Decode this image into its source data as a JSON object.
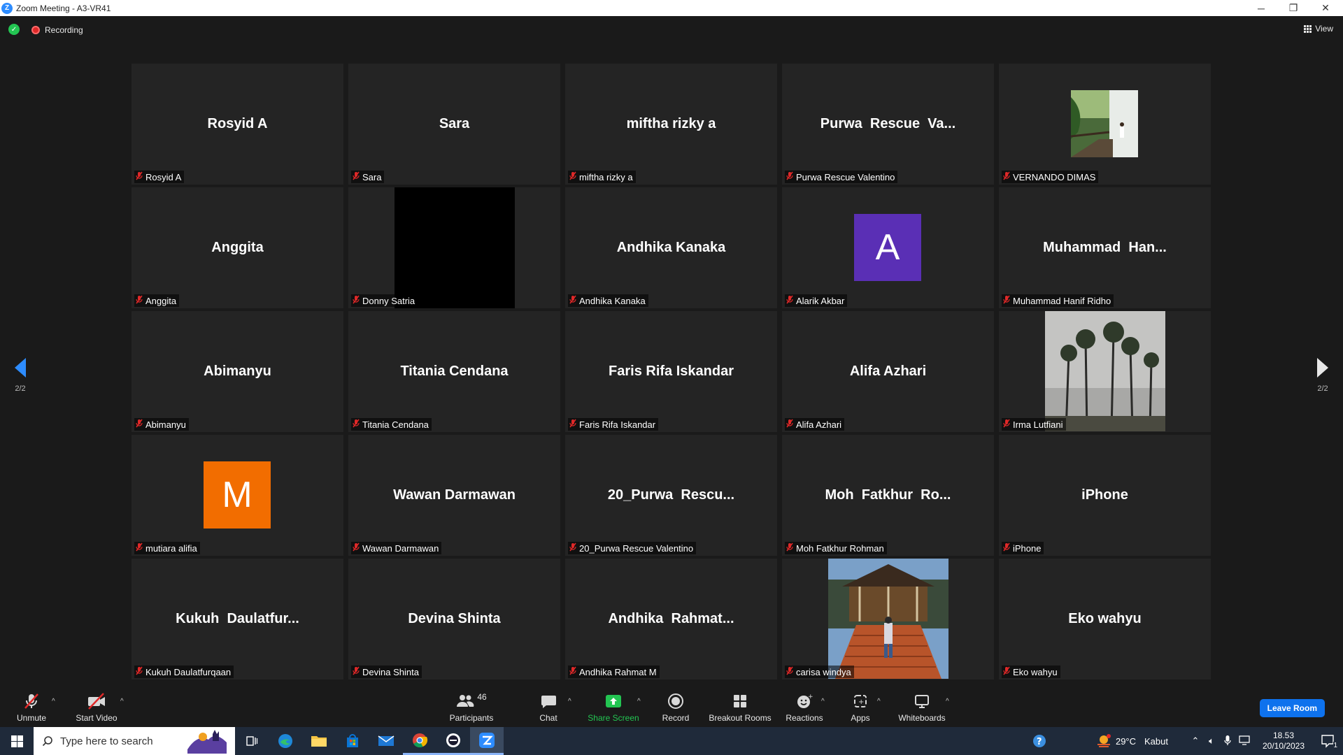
{
  "window": {
    "title": "Zoom Meeting - A3-VR41",
    "logo_letter": "Z",
    "min_glyph": "─",
    "restore_glyph": "❐",
    "close_glyph": "✕"
  },
  "topbar": {
    "recording_label": "Recording",
    "view_label": "View"
  },
  "pagination": {
    "left": "2/2",
    "right": "2/2"
  },
  "tiles": [
    {
      "display": "Rosyid A",
      "label": "Rosyid A",
      "kind": "name"
    },
    {
      "display": "Sara",
      "label": "Sara",
      "kind": "name"
    },
    {
      "display": "miftha rizky a",
      "label": "miftha rizky a",
      "kind": "name"
    },
    {
      "display": "Purwa  Rescue  Va...",
      "label": "Purwa Rescue Valentino",
      "kind": "name"
    },
    {
      "display": "",
      "label": "VERNANDO DIMAS",
      "kind": "photo-jungle"
    },
    {
      "display": "Anggita",
      "label": "Anggita",
      "kind": "name"
    },
    {
      "display": "",
      "label": "Donny Satria",
      "kind": "black"
    },
    {
      "display": "Andhika Kanaka",
      "label": "Andhika Kanaka",
      "kind": "name"
    },
    {
      "display": "A",
      "label": "Alarik Akbar",
      "kind": "avatar-purple"
    },
    {
      "display": "Muhammad  Han...",
      "label": "Muhammad Hanif Ridho",
      "kind": "name"
    },
    {
      "display": "Abimanyu",
      "label": "Abimanyu",
      "kind": "name"
    },
    {
      "display": "Titania Cendana",
      "label": "Titania Cendana",
      "kind": "name"
    },
    {
      "display": "Faris Rifa Iskandar",
      "label": "Faris Rifa Iskandar",
      "kind": "name"
    },
    {
      "display": "Alifa Azhari",
      "label": "Alifa Azhari",
      "kind": "name"
    },
    {
      "display": "",
      "label": "Irma Lutfiani",
      "kind": "photo-trees"
    },
    {
      "display": "M",
      "label": "mutiara alifia",
      "kind": "avatar-orange"
    },
    {
      "display": "Wawan Darmawan",
      "label": "Wawan Darmawan",
      "kind": "name"
    },
    {
      "display": "20_Purwa  Rescu...",
      "label": "20_Purwa Rescue Valentino",
      "kind": "name"
    },
    {
      "display": "Moh  Fatkhur  Ro...",
      "label": "Moh Fatkhur Rohman",
      "kind": "name"
    },
    {
      "display": "iPhone",
      "label": "iPhone",
      "kind": "name"
    },
    {
      "display": "Kukuh  Daulatfur...",
      "label": "Kukuh Daulatfurqaan",
      "kind": "name"
    },
    {
      "display": "Devina Shinta",
      "label": "Devina Shinta",
      "kind": "name"
    },
    {
      "display": "Andhika  Rahmat...",
      "label": "Andhika Rahmat M",
      "kind": "name"
    },
    {
      "display": "",
      "label": "carisa windya",
      "kind": "photo-pavilion"
    },
    {
      "display": "Eko wahyu",
      "label": "Eko wahyu",
      "kind": "name"
    }
  ],
  "toolbar": {
    "unmute": "Unmute",
    "start_video": "Start Video",
    "participants": "Participants",
    "participants_count": "46",
    "chat": "Chat",
    "share_screen": "Share Screen",
    "record": "Record",
    "breakout_rooms": "Breakout Rooms",
    "reactions": "Reactions",
    "apps": "Apps",
    "whiteboards": "Whiteboards",
    "leave_room": "Leave Room"
  },
  "taskbar": {
    "search_placeholder": "Type here to search",
    "weather_temp": "29°C",
    "weather_desc": "Kabut",
    "time": "18.53",
    "date": "20/10/2023",
    "notification_count": "1"
  },
  "colors": {
    "zoom_blue": "#2d8cff",
    "share_green": "#23c552",
    "leave_blue": "#0e72ed",
    "avatar_purple": "#5a2fb5",
    "avatar_orange": "#f26d00",
    "mute_red": "#e02828"
  }
}
